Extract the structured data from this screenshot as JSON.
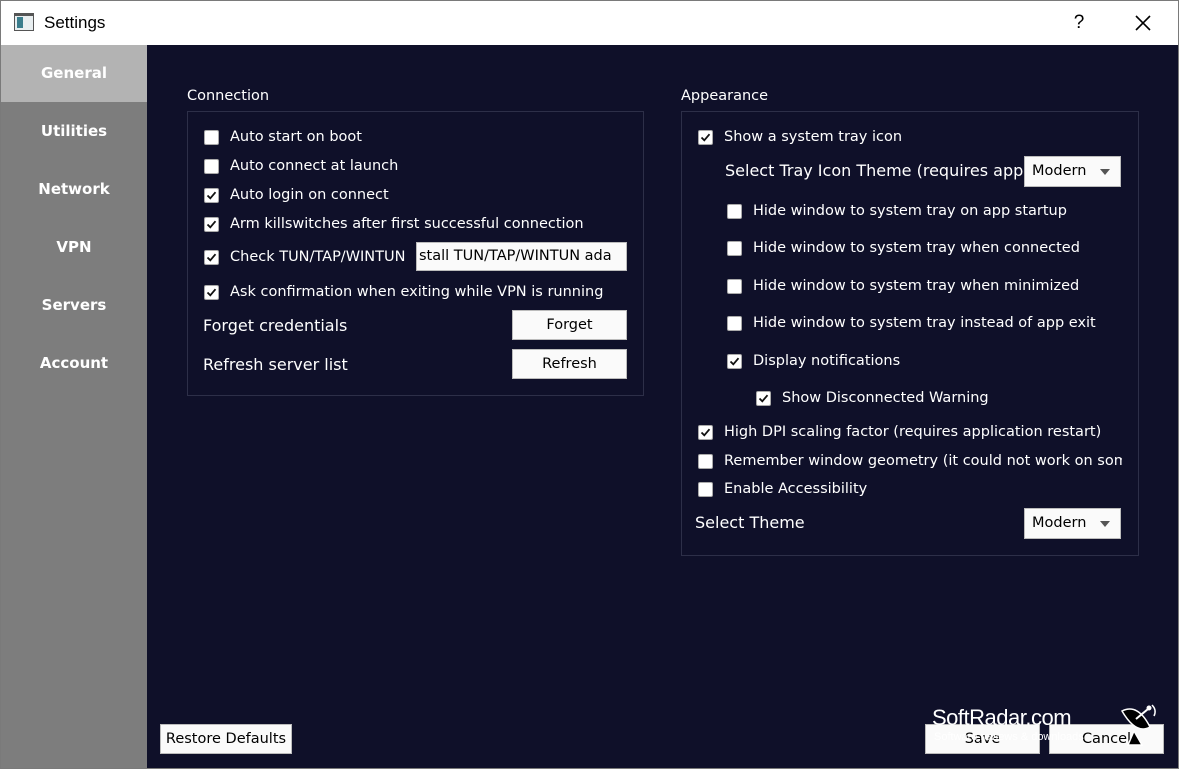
{
  "window": {
    "title": "Settings",
    "help_label": "?"
  },
  "sidebar": {
    "items": [
      {
        "label": "General",
        "active": true
      },
      {
        "label": "Utilities"
      },
      {
        "label": "Network"
      },
      {
        "label": "VPN"
      },
      {
        "label": "Servers"
      },
      {
        "label": "Account"
      }
    ]
  },
  "connection": {
    "title": "Connection",
    "options": [
      {
        "label": "Auto start on boot",
        "checked": false
      },
      {
        "label": "Auto connect at launch",
        "checked": false
      },
      {
        "label": "Auto login on connect",
        "checked": true
      },
      {
        "label": "Arm killswitches after first successful connection",
        "checked": true
      },
      {
        "label": "Check TUN/TAP/WINTUN",
        "checked": true
      },
      {
        "label": "Ask confirmation when exiting while VPN is running",
        "checked": true
      }
    ],
    "install_button": "stall TUN/TAP/WINTUN ada",
    "forget_label": "Forget credentials",
    "forget_button": "Forget",
    "refresh_label": "Refresh server list",
    "refresh_button": "Refresh"
  },
  "appearance": {
    "title": "Appearance",
    "tray_icon": {
      "label": "Show a system tray icon",
      "checked": true
    },
    "tray_theme_label": "Select Tray Icon Theme (requires applic",
    "tray_theme_value": "Modern",
    "tray_options": [
      {
        "label": "Hide window to system tray on app startup",
        "checked": false
      },
      {
        "label": "Hide window to system tray when connected",
        "checked": false
      },
      {
        "label": "Hide window to system tray when minimized",
        "checked": false
      },
      {
        "label": "Hide window to system tray instead of app exit",
        "checked": false
      },
      {
        "label": "Display notifications",
        "checked": true
      }
    ],
    "disconnected_warning": {
      "label": "Show Disconnected Warning",
      "checked": true
    },
    "general_options": [
      {
        "label": "High DPI scaling factor (requires application restart)",
        "checked": true
      },
      {
        "label": "Remember window geometry (it could not work on som",
        "checked": false
      },
      {
        "label": "Enable Accessibility",
        "checked": false
      }
    ],
    "theme_label": "Select Theme",
    "theme_value": "Modern"
  },
  "footer": {
    "restore_label": "Restore Defaults",
    "save_label": "Save",
    "cancel_label": "Cancel"
  },
  "watermark": {
    "brand": "SoftRadar.com",
    "tagline": "Software reviews & downloads"
  },
  "colors": {
    "sidebar_bg": "#7d7d7d",
    "sidebar_active": "#b3b3b3",
    "content_bg": "#0f1029",
    "group_border": "#2d2f48"
  }
}
